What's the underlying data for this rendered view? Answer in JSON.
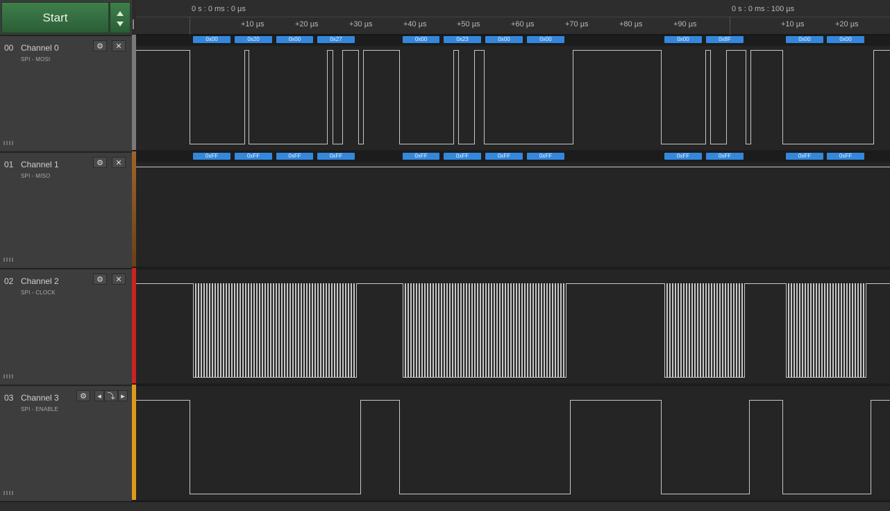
{
  "toolbar": {
    "start_label": "Start"
  },
  "ruler": {
    "time_start": "0 s : 0 ms : 0 µs",
    "time_mid": "0 s : 0 ms : 100 µs",
    "ticks": [
      "+10 µs",
      "+20 µs",
      "+30 µs",
      "+40 µs",
      "+50 µs",
      "+60 µs",
      "+70 µs",
      "+80 µs",
      "+90 µs",
      "+10 µs",
      "+20 µs"
    ]
  },
  "channels": [
    {
      "index": "00",
      "name": "Channel 0",
      "sub": "SPI - MOSI",
      "color": "#888888"
    },
    {
      "index": "01",
      "name": "Channel 1",
      "sub": "SPI - MISO",
      "color": "#8a5a2a"
    },
    {
      "index": "02",
      "name": "Channel 2",
      "sub": "SPI - CLOCK",
      "color": "#cc2222"
    },
    {
      "index": "03",
      "name": "Channel 3",
      "sub": "SPI - ENABLE",
      "color": "#e09a1a"
    }
  ],
  "mosi_bytes": [
    "0x00",
    "0x20",
    "0x00",
    "0x27",
    "0x00",
    "0x23",
    "0x00",
    "0x00",
    "0x00",
    "0x8F",
    "0x00",
    "0x00"
  ],
  "miso_bytes": [
    "0xFF",
    "0xFF",
    "0xFF",
    "0xFF",
    "0xFF",
    "0xFF",
    "0xFF",
    "0xFF",
    "0xFF",
    "0xFF",
    "0xFF",
    "0xFF"
  ],
  "icons": {
    "settings": "gear-icon",
    "close": "close-icon",
    "trigger": "falling-edge-trigger-icon"
  }
}
